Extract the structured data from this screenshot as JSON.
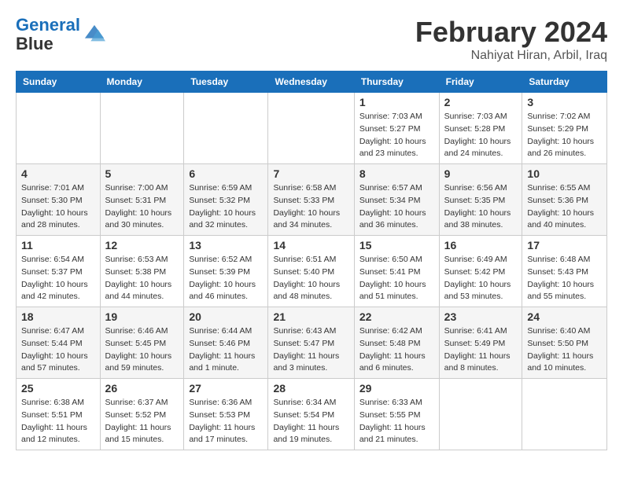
{
  "logo": {
    "line1": "General",
    "line2": "Blue"
  },
  "title": "February 2024",
  "location": "Nahiyat Hiran, Arbil, Iraq",
  "days_header": [
    "Sunday",
    "Monday",
    "Tuesday",
    "Wednesday",
    "Thursday",
    "Friday",
    "Saturday"
  ],
  "weeks": [
    [
      {
        "day": "",
        "info": ""
      },
      {
        "day": "",
        "info": ""
      },
      {
        "day": "",
        "info": ""
      },
      {
        "day": "",
        "info": ""
      },
      {
        "day": "1",
        "sunrise": "7:03 AM",
        "sunset": "5:27 PM",
        "daylight": "10 hours and 23 minutes."
      },
      {
        "day": "2",
        "sunrise": "7:03 AM",
        "sunset": "5:28 PM",
        "daylight": "10 hours and 24 minutes."
      },
      {
        "day": "3",
        "sunrise": "7:02 AM",
        "sunset": "5:29 PM",
        "daylight": "10 hours and 26 minutes."
      }
    ],
    [
      {
        "day": "4",
        "sunrise": "7:01 AM",
        "sunset": "5:30 PM",
        "daylight": "10 hours and 28 minutes."
      },
      {
        "day": "5",
        "sunrise": "7:00 AM",
        "sunset": "5:31 PM",
        "daylight": "10 hours and 30 minutes."
      },
      {
        "day": "6",
        "sunrise": "6:59 AM",
        "sunset": "5:32 PM",
        "daylight": "10 hours and 32 minutes."
      },
      {
        "day": "7",
        "sunrise": "6:58 AM",
        "sunset": "5:33 PM",
        "daylight": "10 hours and 34 minutes."
      },
      {
        "day": "8",
        "sunrise": "6:57 AM",
        "sunset": "5:34 PM",
        "daylight": "10 hours and 36 minutes."
      },
      {
        "day": "9",
        "sunrise": "6:56 AM",
        "sunset": "5:35 PM",
        "daylight": "10 hours and 38 minutes."
      },
      {
        "day": "10",
        "sunrise": "6:55 AM",
        "sunset": "5:36 PM",
        "daylight": "10 hours and 40 minutes."
      }
    ],
    [
      {
        "day": "11",
        "sunrise": "6:54 AM",
        "sunset": "5:37 PM",
        "daylight": "10 hours and 42 minutes."
      },
      {
        "day": "12",
        "sunrise": "6:53 AM",
        "sunset": "5:38 PM",
        "daylight": "10 hours and 44 minutes."
      },
      {
        "day": "13",
        "sunrise": "6:52 AM",
        "sunset": "5:39 PM",
        "daylight": "10 hours and 46 minutes."
      },
      {
        "day": "14",
        "sunrise": "6:51 AM",
        "sunset": "5:40 PM",
        "daylight": "10 hours and 48 minutes."
      },
      {
        "day": "15",
        "sunrise": "6:50 AM",
        "sunset": "5:41 PM",
        "daylight": "10 hours and 51 minutes."
      },
      {
        "day": "16",
        "sunrise": "6:49 AM",
        "sunset": "5:42 PM",
        "daylight": "10 hours and 53 minutes."
      },
      {
        "day": "17",
        "sunrise": "6:48 AM",
        "sunset": "5:43 PM",
        "daylight": "10 hours and 55 minutes."
      }
    ],
    [
      {
        "day": "18",
        "sunrise": "6:47 AM",
        "sunset": "5:44 PM",
        "daylight": "10 hours and 57 minutes."
      },
      {
        "day": "19",
        "sunrise": "6:46 AM",
        "sunset": "5:45 PM",
        "daylight": "10 hours and 59 minutes."
      },
      {
        "day": "20",
        "sunrise": "6:44 AM",
        "sunset": "5:46 PM",
        "daylight": "11 hours and 1 minute."
      },
      {
        "day": "21",
        "sunrise": "6:43 AM",
        "sunset": "5:47 PM",
        "daylight": "11 hours and 3 minutes."
      },
      {
        "day": "22",
        "sunrise": "6:42 AM",
        "sunset": "5:48 PM",
        "daylight": "11 hours and 6 minutes."
      },
      {
        "day": "23",
        "sunrise": "6:41 AM",
        "sunset": "5:49 PM",
        "daylight": "11 hours and 8 minutes."
      },
      {
        "day": "24",
        "sunrise": "6:40 AM",
        "sunset": "5:50 PM",
        "daylight": "11 hours and 10 minutes."
      }
    ],
    [
      {
        "day": "25",
        "sunrise": "6:38 AM",
        "sunset": "5:51 PM",
        "daylight": "11 hours and 12 minutes."
      },
      {
        "day": "26",
        "sunrise": "6:37 AM",
        "sunset": "5:52 PM",
        "daylight": "11 hours and 15 minutes."
      },
      {
        "day": "27",
        "sunrise": "6:36 AM",
        "sunset": "5:53 PM",
        "daylight": "11 hours and 17 minutes."
      },
      {
        "day": "28",
        "sunrise": "6:34 AM",
        "sunset": "5:54 PM",
        "daylight": "11 hours and 19 minutes."
      },
      {
        "day": "29",
        "sunrise": "6:33 AM",
        "sunset": "5:55 PM",
        "daylight": "11 hours and 21 minutes."
      },
      {
        "day": "",
        "info": ""
      },
      {
        "day": "",
        "info": ""
      }
    ]
  ],
  "labels": {
    "sunrise_prefix": "Sunrise: ",
    "sunset_prefix": "Sunset: ",
    "daylight_label": "Daylight: "
  }
}
